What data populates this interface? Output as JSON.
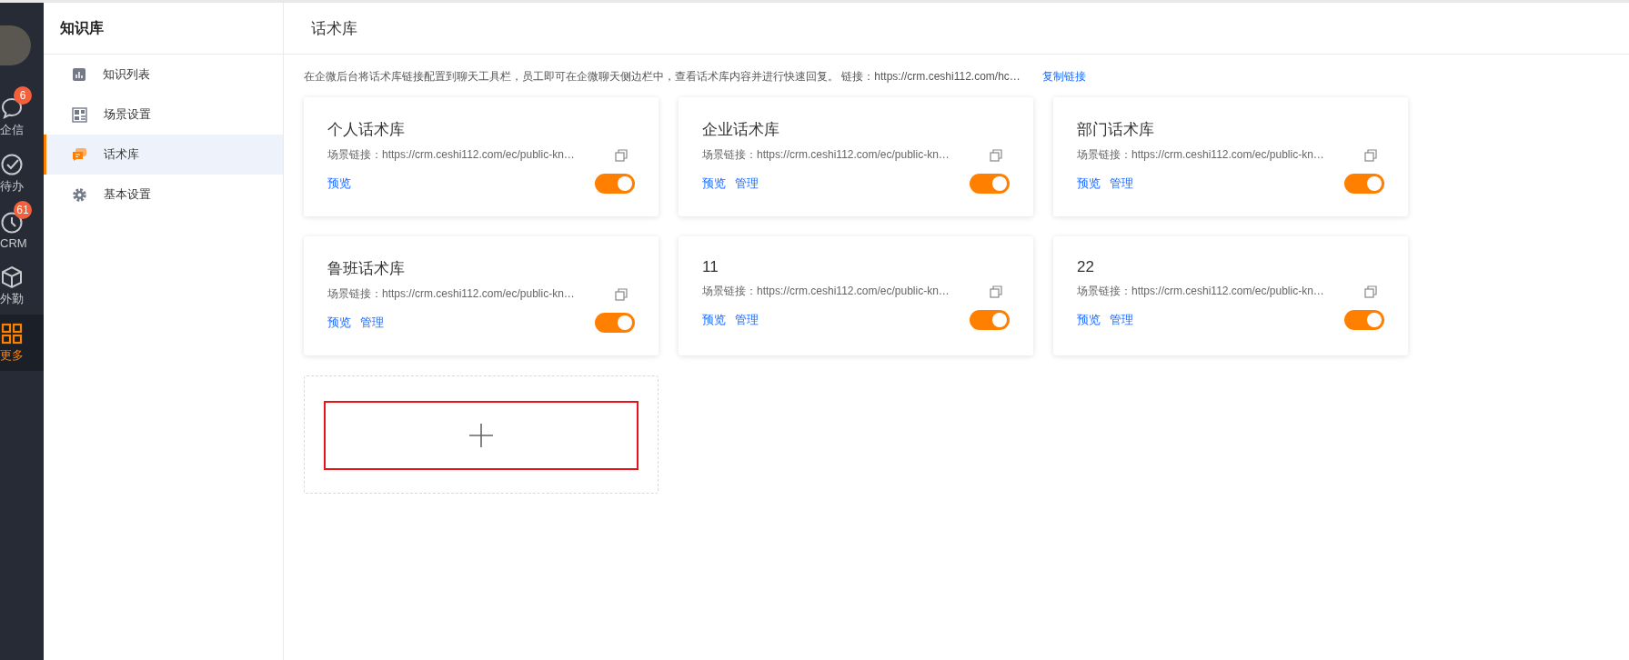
{
  "rail": {
    "items": [
      {
        "label": "企信",
        "badge": "6",
        "selected": false
      },
      {
        "label": "待办",
        "selected": false
      },
      {
        "label": "CRM",
        "badge": "61",
        "selected": false
      },
      {
        "label": "外勤",
        "selected": false
      },
      {
        "label": "更多",
        "selected": true
      }
    ]
  },
  "sidebar": {
    "title": "知识库",
    "items": [
      {
        "label": "知识列表",
        "selected": false
      },
      {
        "label": "场景设置",
        "selected": false
      },
      {
        "label": "话术库",
        "selected": true
      },
      {
        "label": "基本设置",
        "selected": false
      }
    ]
  },
  "header": {
    "title": "话术库"
  },
  "notice": {
    "text": "在企微后台将话术库链接配置到聊天工具栏，员工即可在企微聊天侧边栏中，查看话术库内容并进行快速回复。 链接：https://crm.ceshi112.com/hc…",
    "link": "复制链接"
  },
  "cards": [
    {
      "title": "个人话术库",
      "link": "场景链接：https://crm.ceshi112.com/ec/public-kn…",
      "actions": [
        "预览"
      ],
      "on": true
    },
    {
      "title": "企业话术库",
      "link": "场景链接：https://crm.ceshi112.com/ec/public-kn…",
      "actions": [
        "预览",
        "管理"
      ],
      "on": true
    },
    {
      "title": "部门话术库",
      "link": "场景链接：https://crm.ceshi112.com/ec/public-kn…",
      "actions": [
        "预览",
        "管理"
      ],
      "on": true
    },
    {
      "title": "鲁班话术库",
      "link": "场景链接：https://crm.ceshi112.com/ec/public-kn…",
      "actions": [
        "预览",
        "管理"
      ],
      "on": true
    },
    {
      "title": "11",
      "link": "场景链接：https://crm.ceshi112.com/ec/public-kn…",
      "actions": [
        "预览",
        "管理"
      ],
      "on": true
    },
    {
      "title": "22",
      "link": "场景链接：https://crm.ceshi112.com/ec/public-kn…",
      "actions": [
        "预览",
        "管理"
      ],
      "on": true
    }
  ]
}
